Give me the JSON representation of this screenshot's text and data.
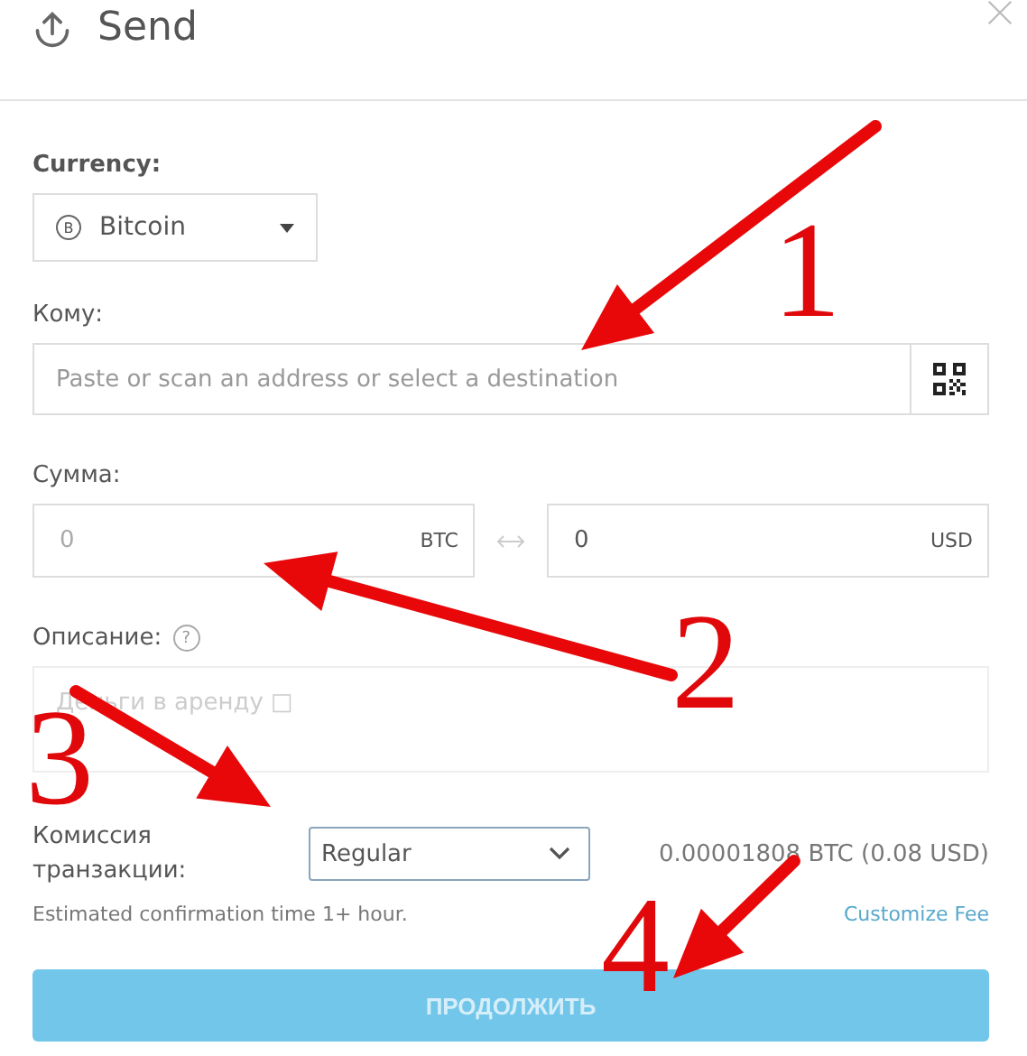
{
  "dialog": {
    "title": "Send"
  },
  "currency": {
    "label": "Currency:",
    "value": "Bitcoin",
    "coin_symbol": "B"
  },
  "recipient": {
    "label": "Кому:",
    "placeholder": "Paste or scan an address or select a destination"
  },
  "amount": {
    "label": "Сумма:",
    "crypto": {
      "placeholder": "0",
      "unit": "BTC"
    },
    "fiat": {
      "value": "0",
      "unit": "USD"
    }
  },
  "description": {
    "label": "Описание:",
    "help": "?",
    "placeholder": "Деньги в аренду □"
  },
  "fee": {
    "label": "Комиссия транзакции:",
    "selected_option": "Regular",
    "amount": "0.00001808 BTC (0.08 USD)",
    "estimate": "Estimated confirmation time 1+ hour.",
    "customize_link": "Customize Fee"
  },
  "continue_button": {
    "label": "ПРОДОЛЖИТЬ",
    "disabled": true
  },
  "annotations": [
    {
      "number": "1"
    },
    {
      "number": "2"
    },
    {
      "number": "3"
    },
    {
      "number": "4"
    }
  ]
}
